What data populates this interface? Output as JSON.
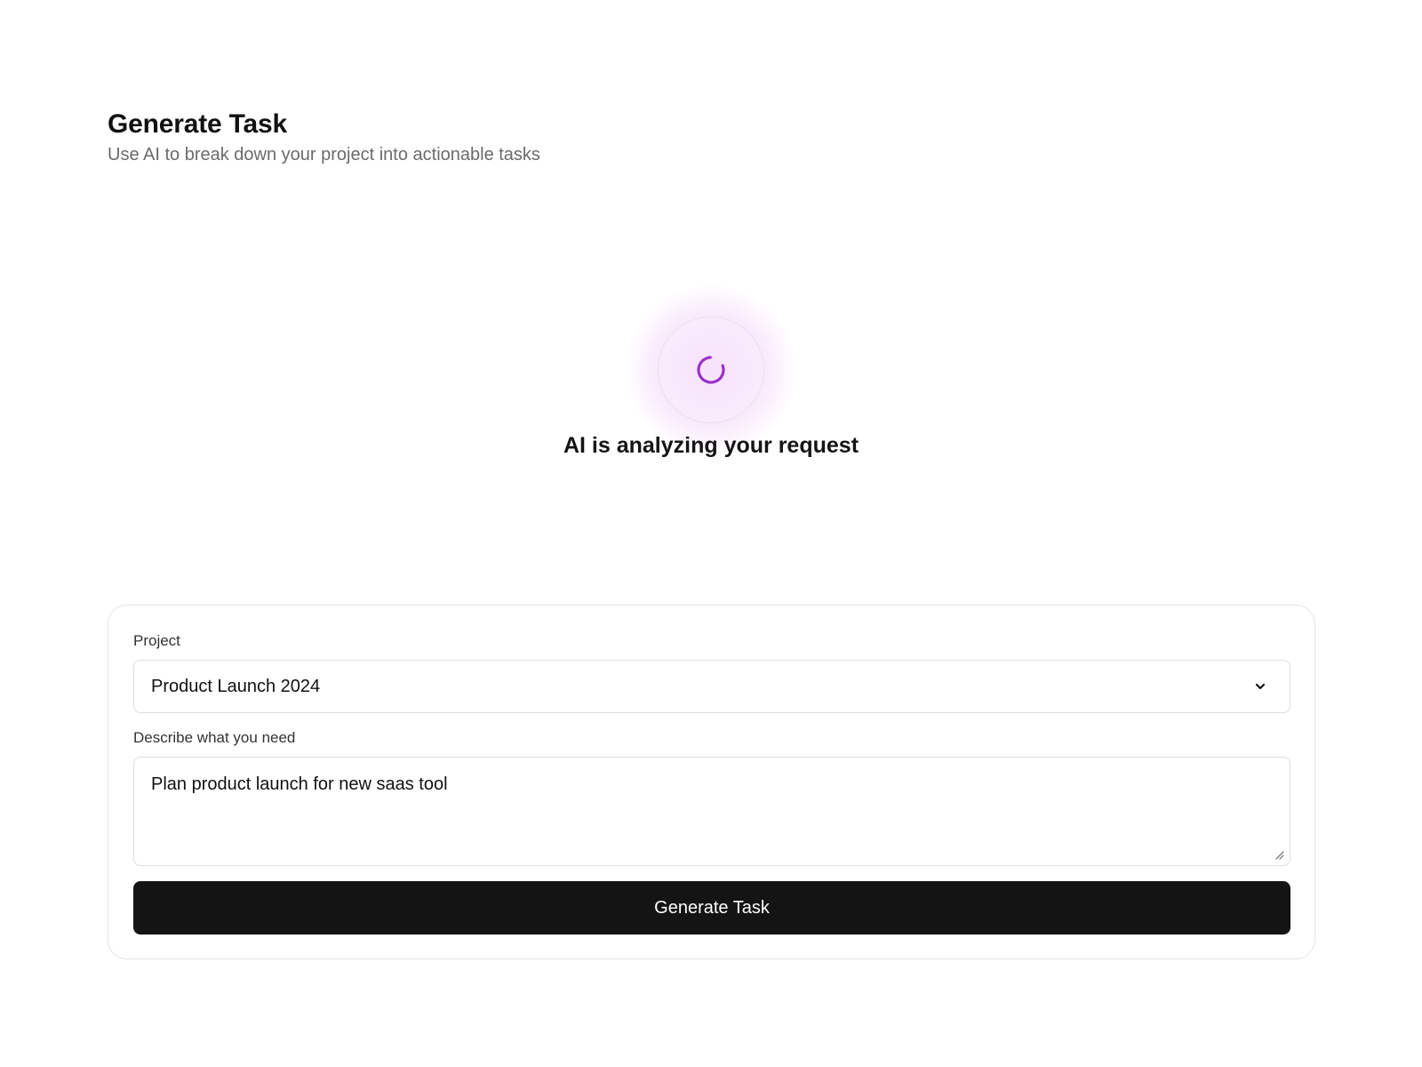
{
  "header": {
    "title": "Generate Task",
    "subtitle": "Use AI to break down your project into actionable tasks"
  },
  "loading": {
    "status_text": "AI is analyzing your request",
    "spinner_icon": "spinner-icon",
    "accent_color": "#9b2fc9"
  },
  "form": {
    "project_label": "Project",
    "project_selected": "Product Launch 2024",
    "project_chevron_icon": "chevron-down-icon",
    "describe_label": "Describe what you need",
    "describe_value": "Plan product launch for new saas tool",
    "submit_label": "Generate Task"
  }
}
